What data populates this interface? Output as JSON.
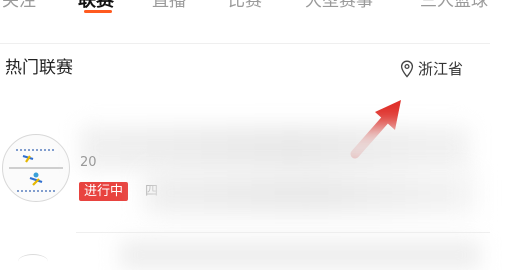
{
  "tabs": [
    {
      "label": "关注",
      "active": false
    },
    {
      "label": "联赛",
      "active": true
    },
    {
      "label": "直播",
      "active": false
    },
    {
      "label": "比赛",
      "active": false
    },
    {
      "label": "大型赛事",
      "active": false
    },
    {
      "label": "三人篮球",
      "active": false
    }
  ],
  "section": {
    "title": "热门联赛",
    "location": "浙江省",
    "location_icon": "map-pin-icon"
  },
  "league_item": {
    "year_prefix": "20",
    "status": "进行中",
    "meta_char": "四",
    "avatar_icon": "league-logo"
  },
  "colors": {
    "accent": "#ff5a1f",
    "status_red": "#e8433f",
    "annotation_arrow": "#e0302a"
  }
}
